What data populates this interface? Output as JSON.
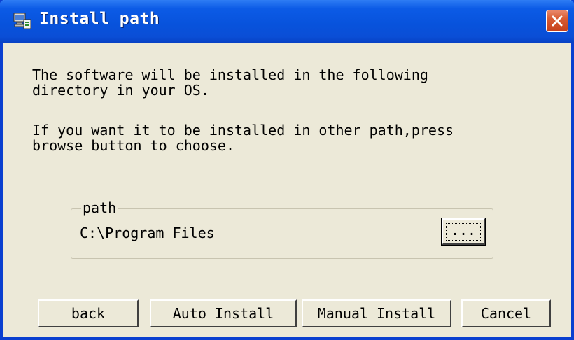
{
  "window": {
    "title": "Install path",
    "icon": "installer-computer-icon",
    "close_icon": "close-icon"
  },
  "message": {
    "line1": "The software will be installed in the following\ndirectory in your OS.",
    "line2": "If you want it to be installed in other path,press\nbrowse button to choose."
  },
  "path_group": {
    "legend": "path",
    "value": "C:\\Program Files",
    "browse_label": "..."
  },
  "buttons": {
    "back": "back",
    "auto_install": "Auto Install",
    "manual_install": "Manual Install",
    "cancel": "Cancel"
  },
  "colors": {
    "titlebar": "#0a53dc",
    "window_bg": "#ece9d8",
    "close_button": "#d85b33"
  }
}
